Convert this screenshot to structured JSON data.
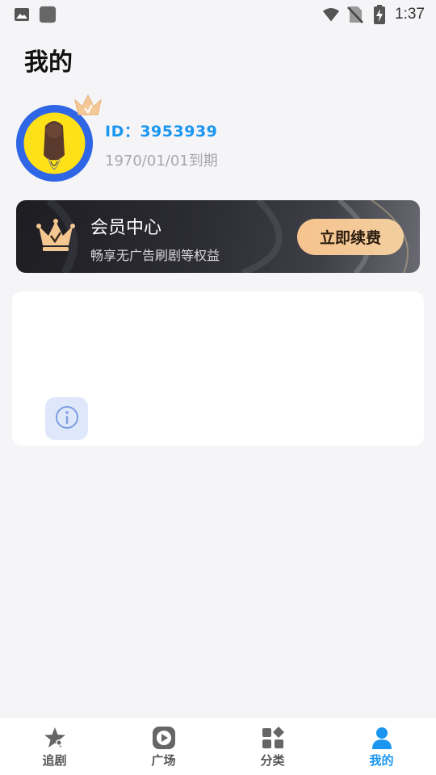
{
  "status_bar": {
    "time": "1:37",
    "left_icons": [
      "image-icon",
      "app-icon"
    ],
    "right_icons": [
      "wifi-icon",
      "no-sim-icon",
      "battery-charging-icon"
    ]
  },
  "page": {
    "title": "我的"
  },
  "profile": {
    "id_text": "ID：3953939",
    "expire_text": "1970/01/01到期",
    "avatar_icon": "avatar",
    "badge_icon": "crown-badge-icon"
  },
  "vip": {
    "title": "会员中心",
    "subtitle": "畅享无广告刷剧等权益",
    "button_label": "立即续费",
    "icon": "vip-crown-icon"
  },
  "content_card": {
    "icon": "info-icon"
  },
  "bottom_nav": {
    "items": [
      {
        "label": "追剧",
        "icon": "star-icon",
        "active": false
      },
      {
        "label": "广场",
        "icon": "play-icon",
        "active": false
      },
      {
        "label": "分类",
        "icon": "category-icon",
        "active": false
      },
      {
        "label": "我的",
        "icon": "user-icon",
        "active": true
      }
    ]
  },
  "colors": {
    "accent": "#1a96f0",
    "background": "#f5f5f8",
    "vip_button": "#f6c38e",
    "inactive_nav": "#555555"
  }
}
